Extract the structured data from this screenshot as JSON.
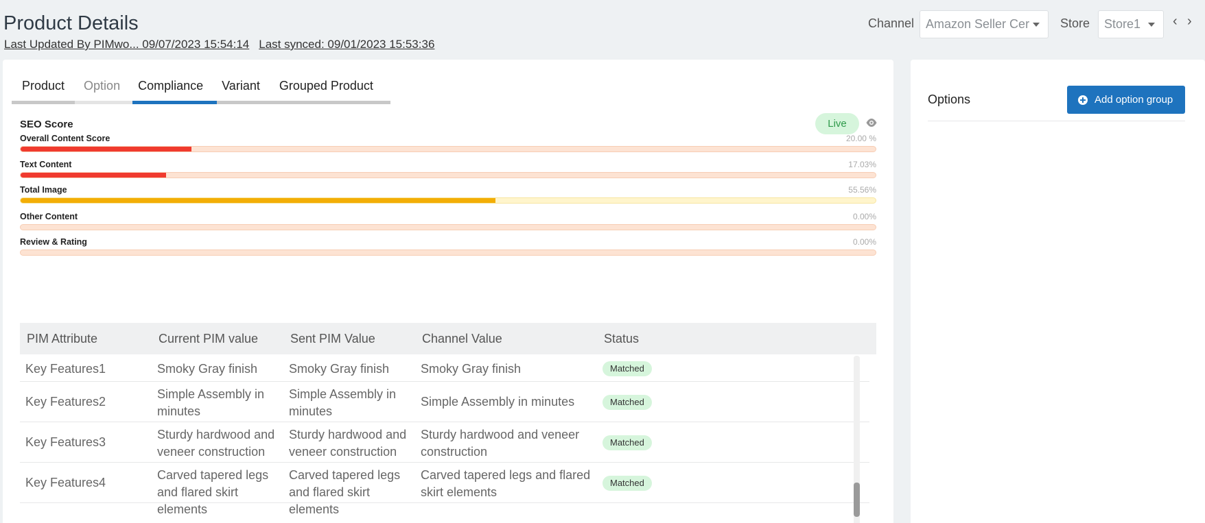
{
  "header": {
    "title": "Product Details",
    "last_updated": "Last Updated By  PIMwo...   09/07/2023 15:54:14",
    "last_synced": "Last synced: 09/01/2023 15:53:36",
    "channel_label": "Channel",
    "channel_value": "Amazon Seller Cer",
    "store_label": "Store",
    "store_value": "Store1",
    "prev_icon": "‹",
    "next_icon": "›"
  },
  "tabs": [
    {
      "label": "Product",
      "state": "normal"
    },
    {
      "label": "Option",
      "state": "muted"
    },
    {
      "label": "Compliance",
      "state": "active"
    },
    {
      "label": "Variant",
      "state": "normal"
    },
    {
      "label": "Grouped Product",
      "state": "normal"
    }
  ],
  "seo": {
    "title": "SEO Score",
    "status": "Live",
    "scores": [
      {
        "label": "Overall Content Score",
        "value": "20.00 %",
        "fill": 20.0,
        "color": "red"
      },
      {
        "label": "Text Content",
        "value": "17.03%",
        "fill": 17.03,
        "color": "red"
      },
      {
        "label": "Total Image",
        "value": "55.56%",
        "fill": 55.56,
        "color": "yellow"
      },
      {
        "label": "Other Content",
        "value": "0.00%",
        "fill": 0,
        "color": "red"
      },
      {
        "label": "Review & Rating",
        "value": "0.00%",
        "fill": 0,
        "color": "red"
      }
    ]
  },
  "table": {
    "headers": [
      "PIM Attribute",
      "Current PIM value",
      "Sent PIM Value",
      "Channel Value",
      "Status"
    ],
    "rows": [
      {
        "attribute": "Key Features1",
        "current": "Smoky Gray finish",
        "sent": "Smoky Gray finish",
        "channel": "Smoky Gray finish",
        "status": "Matched"
      },
      {
        "attribute": "Key Features2",
        "current": "Simple Assembly in minutes",
        "sent": "Simple Assembly in minutes",
        "channel": "Simple Assembly in minutes",
        "status": "Matched"
      },
      {
        "attribute": "Key Features3",
        "current": "Sturdy hardwood and veneer construction",
        "sent": "Sturdy hardwood and veneer construction",
        "channel": "Sturdy hardwood and veneer construction",
        "status": "Matched"
      },
      {
        "attribute": "Key Features4",
        "current": "Carved tapered legs and flared skirt elements",
        "sent": "Carved tapered legs and flared skirt elements",
        "channel": "Carved tapered legs and flared skirt elements",
        "status": "Matched"
      }
    ]
  },
  "options": {
    "title": "Options",
    "add_button": "Add option group"
  },
  "colors": {
    "accent": "#1e73be",
    "bar_red": "#f03a2e",
    "bar_yellow": "#f3ae06",
    "status_green_bg": "#d6f5dc"
  }
}
